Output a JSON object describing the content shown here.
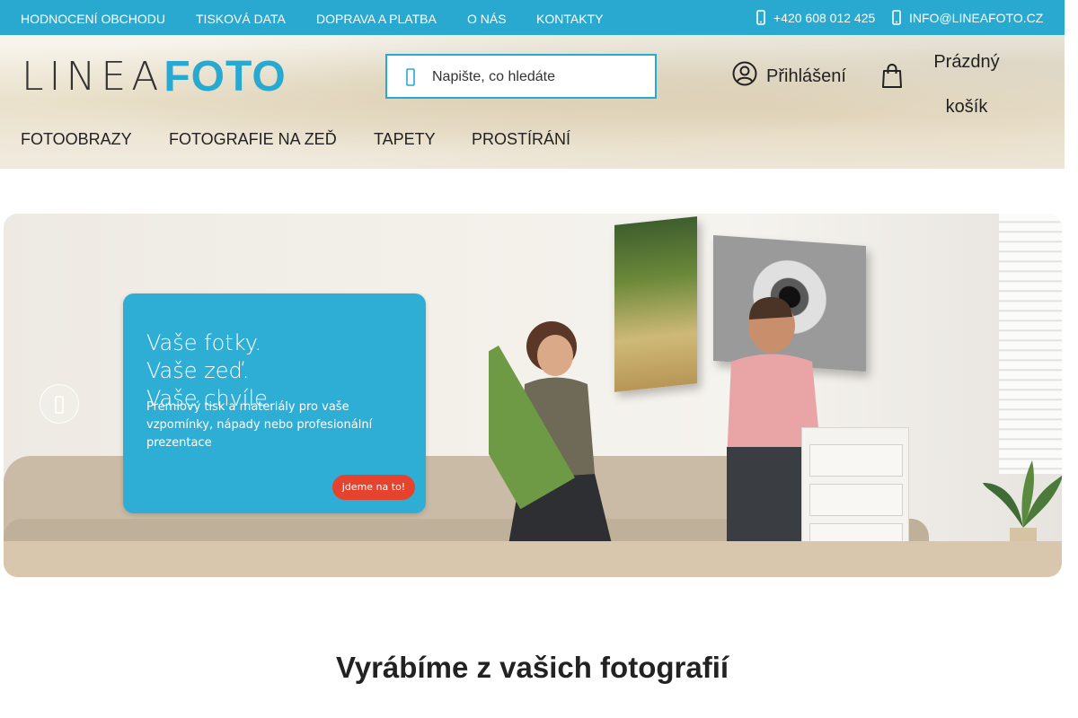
{
  "topbar": {
    "links": [
      {
        "label": "HODNOCENÍ OBCHODU"
      },
      {
        "label": "TISKOVÁ DATA"
      },
      {
        "label": "DOPRAVA A PLATBA"
      },
      {
        "label": "O NÁS"
      },
      {
        "label": "KONTAKTY"
      }
    ],
    "phone": "+420 608 012 425",
    "phone_icon": "phone-icon",
    "email": "INFO@LINEAFOTO.CZ",
    "email_icon": "envelope-icon",
    "background": "#29a9d0"
  },
  "header": {
    "logo_light": "LINEA",
    "logo_bold": "FOTO",
    "search": {
      "placeholder": "Napište, co hledáte",
      "icon": "search-icon"
    },
    "login_label": "Přihlášení",
    "login_icon": "user-circle-icon",
    "cart_icon": "shopping-bag-icon",
    "cart_label": "Prázdný košík"
  },
  "nav": {
    "items": [
      {
        "label": "FOTOOBRAZY"
      },
      {
        "label": "FOTOGRAFIE NA ZEĎ"
      },
      {
        "label": "TAPETY"
      },
      {
        "label": "PROSTÍRÁNÍ"
      }
    ]
  },
  "hero": {
    "heading": "Vaše fotky. Vaše zeď. Vaše chvíle.",
    "text": "Prémiový tisk a materiály pro vaše vzpomínky, nápady nebo profesionální prezentace",
    "cta": "jdeme na to!",
    "prev_icon": "chevron-left-icon",
    "card_color": "#2faed5",
    "cta_color": "#e5432e"
  },
  "section": {
    "title": "Vyrábíme z vašich fotografií"
  }
}
